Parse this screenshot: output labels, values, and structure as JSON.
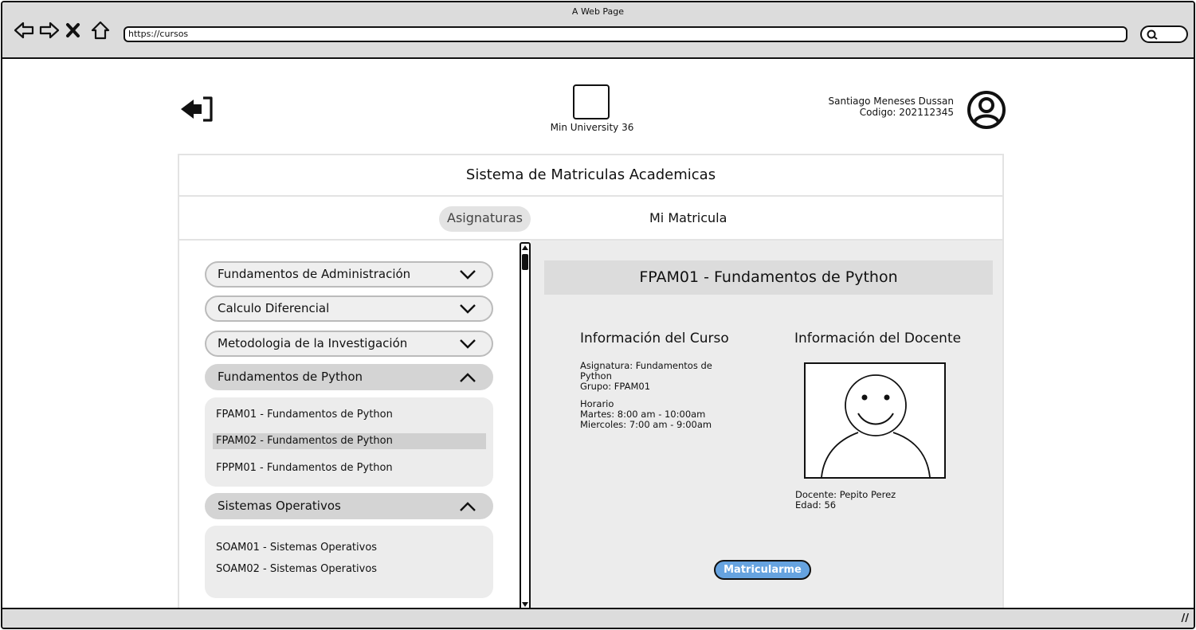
{
  "browser": {
    "window_title": "A Web Page",
    "url": "https://cursos"
  },
  "header": {
    "logo_text": "Min University 36",
    "user_name": "Santiago Meneses Dussan",
    "user_code": "Codigo: 202112345"
  },
  "panel": {
    "title": "Sistema de Matriculas Academicas",
    "tabs": [
      {
        "label": "Asignaturas",
        "active": true
      },
      {
        "label": "Mi Matricula",
        "active": false
      }
    ]
  },
  "subjects": [
    {
      "label": "Fundamentos de Administración",
      "expanded": false
    },
    {
      "label": "Calculo Diferencial",
      "expanded": false
    },
    {
      "label": "Metodologia de la Investigación",
      "expanded": false
    },
    {
      "label": "Fundamentos de Python",
      "expanded": true,
      "groups": [
        "FPAM01 - Fundamentos de Python",
        "FPAM02 - Fundamentos de Python",
        "FPPM01 - Fundamentos de Python"
      ],
      "selected_group": "FPAM02 - Fundamentos de Python"
    },
    {
      "label": "Sistemas Operativos",
      "expanded": true,
      "groups": [
        "SOAM01 - Sistemas Operativos",
        "SOAM02 - Sistemas Operativos"
      ]
    }
  ],
  "course_detail": {
    "heading": "FPAM01 - Fundamentos de Python",
    "course_info_title": "Información del Curso",
    "course_subject_line1": "Asignatura: Fundamentos de",
    "course_subject_line2": "Python",
    "course_group": "Grupo: FPAM01",
    "schedule_title": "Horario",
    "schedule_1": "Martes: 8:00 am - 10:00am",
    "schedule_2": "Miercoles: 7:00 am - 9:00am",
    "teacher_info_title": "Información del Docente",
    "teacher_name": "Docente: Pepito Perez",
    "teacher_age": "Edad: 56",
    "enroll_button": "Matricularme"
  },
  "colors": {
    "chrome": "#dcdcdc",
    "button_blue": "#66a3e0",
    "selected_row": "#d0d0d0",
    "pane_bg": "#ececec"
  }
}
